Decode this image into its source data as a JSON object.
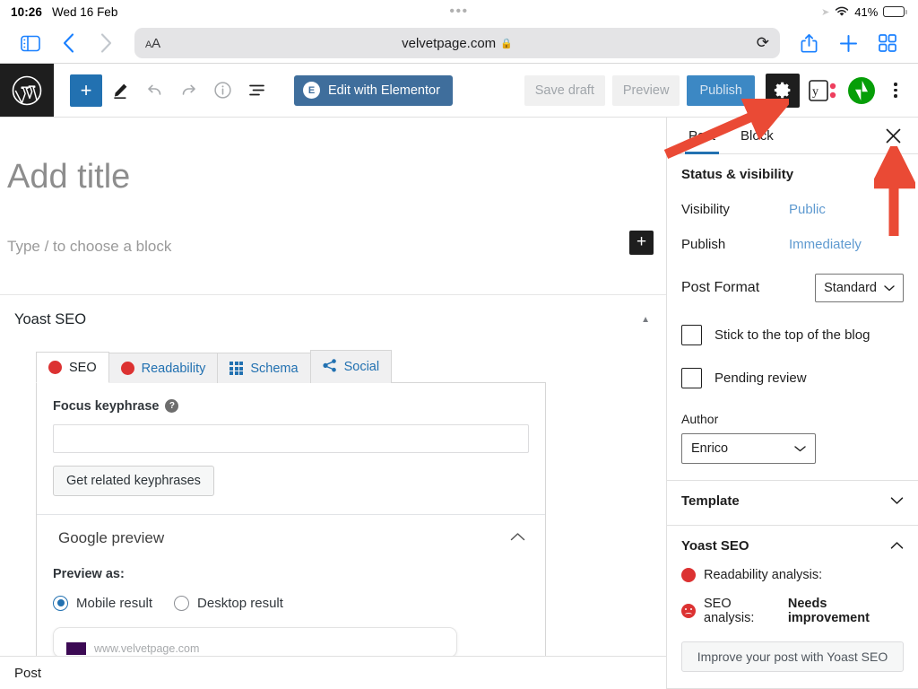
{
  "status_bar": {
    "time": "10:26",
    "date": "Wed 16 Feb",
    "center_dots": "•••",
    "battery_percent": "41%",
    "battery_level": 41,
    "wifi_icon": "wifi-icon",
    "location_icon": "location-arrow-icon"
  },
  "browser": {
    "sidebar_icon": "sidebar-toggle-icon",
    "back_icon": "chevron-left-icon",
    "forward_icon": "chevron-right-icon",
    "aa_label_small": "A",
    "aa_label_large": "A",
    "url": "velvetpage.com",
    "lock_icon": "lock-icon",
    "reload_icon": "reload-icon",
    "share_icon": "share-icon",
    "new_tab_icon": "plus-icon",
    "tabs_icon": "tabs-grid-icon"
  },
  "editor_header": {
    "logo_icon": "wordpress-logo-icon",
    "add_block_label": "+",
    "tools": [
      {
        "name": "block-inserter",
        "icon": "plus-icon"
      },
      {
        "name": "edit-tool",
        "icon": "pencil-icon"
      },
      {
        "name": "undo",
        "icon": "undo-arrow-icon"
      },
      {
        "name": "redo",
        "icon": "redo-arrow-icon"
      },
      {
        "name": "details",
        "icon": "info-circle-icon"
      },
      {
        "name": "list-view",
        "icon": "list-view-icon"
      }
    ],
    "elementor_label": "Edit with Elementor",
    "elementor_badge": "E",
    "save_draft_label": "Save draft",
    "preview_label": "Preview",
    "publish_label": "Publish",
    "settings_icon": "gear-icon",
    "yoast_icon": "yoast-logo-icon",
    "jetpack_icon": "jetpack-logo-icon",
    "more_icon": "kebab-menu-icon",
    "accent_blue": "#2271b1",
    "publish_blue": "#3c88c4"
  },
  "canvas": {
    "title_placeholder": "Add title",
    "block_placeholder": "Type / to choose a block",
    "block_adder_label": "+"
  },
  "yoast_metabox": {
    "title": "Yoast SEO",
    "collapse_icon": "caret-up-icon",
    "tabs": [
      {
        "label": "SEO",
        "icon": "red-dot-icon",
        "active": true
      },
      {
        "label": "Readability",
        "icon": "red-dot-icon",
        "active": false
      },
      {
        "label": "Schema",
        "icon": "schema-grid-icon",
        "active": false
      },
      {
        "label": "Social",
        "icon": "share-nodes-icon",
        "active": false
      }
    ],
    "focus_keyphrase_label": "Focus keyphrase",
    "focus_keyphrase_help": "?",
    "focus_keyphrase_value": "",
    "get_related_label": "Get related keyphrases",
    "google_preview_title": "Google preview",
    "google_preview_collapse_icon": "chevron-up-icon",
    "preview_as_label": "Preview as:",
    "preview_options": [
      {
        "label": "Mobile result",
        "checked": true
      },
      {
        "label": "Desktop result",
        "checked": false
      }
    ],
    "preview_url": "www.velvetpage.com"
  },
  "sidebar": {
    "tabs": [
      {
        "label": "Post",
        "active": true
      },
      {
        "label": "Block",
        "active": false
      }
    ],
    "close_icon": "close-x-icon",
    "status_visibility": {
      "title": "Status & visibility",
      "collapse_icon": "chevron-up-icon",
      "visibility_label": "Visibility",
      "visibility_value": "Public",
      "publish_label": "Publish",
      "publish_value": "Immediately",
      "post_format_label": "Post Format",
      "post_format_value": "Standard",
      "sticky_label": "Stick to the top of the blog",
      "sticky_checked": false,
      "pending_label": "Pending review",
      "pending_checked": false,
      "author_label": "Author",
      "author_value": "Enrico"
    },
    "template": {
      "title": "Template",
      "collapse_icon": "chevron-down-icon"
    },
    "yoast": {
      "title": "Yoast SEO",
      "collapse_icon": "chevron-up-icon",
      "readability_label": "Readability analysis:",
      "readability_value": "",
      "seo_label": "SEO analysis:",
      "seo_value": "Needs improvement",
      "improve_label": "Improve your post with Yoast SEO"
    }
  },
  "bottom_bar": {
    "label": "Post"
  },
  "annotations": {
    "arrow_color": "#ea4a35",
    "arrow_1_target": "gear-icon",
    "arrow_2_target": "close-x-icon"
  }
}
